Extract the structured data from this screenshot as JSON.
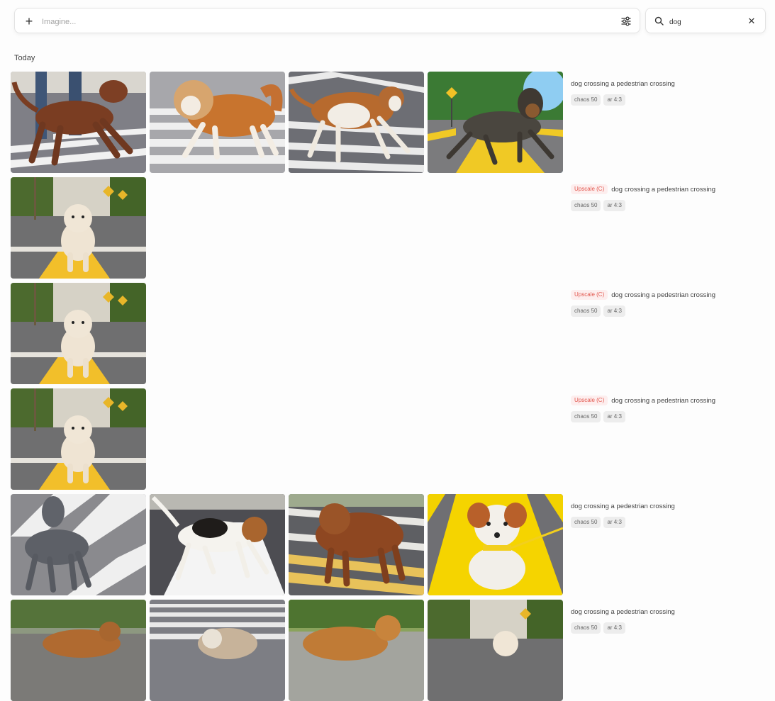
{
  "toolbar": {
    "prompt_placeholder": "Imagine...",
    "prompt_value": "",
    "search_value": "dog",
    "plus_icon": "plus-icon",
    "settings_icon": "sliders-icon",
    "search_icon": "search-icon",
    "clear_icon": "close-icon",
    "plus_glyph": "+",
    "clear_glyph": "✕"
  },
  "section": {
    "label": "Today"
  },
  "rows": [
    {
      "upscale": "",
      "prompt": "dog crossing a pedestrian crossing",
      "params": [
        "chaos 50",
        "ar 4:3"
      ]
    },
    {
      "upscale": "Upscale (C)",
      "prompt": "dog crossing a pedestrian crossing",
      "params": [
        "chaos 50",
        "ar 4:3"
      ]
    },
    {
      "upscale": "Upscale (C)",
      "prompt": "dog crossing a pedestrian crossing",
      "params": [
        "chaos 50",
        "ar 4:3"
      ]
    },
    {
      "upscale": "Upscale (C)",
      "prompt": "dog crossing a pedestrian crossing",
      "params": [
        "chaos 50",
        "ar 4:3"
      ]
    },
    {
      "upscale": "",
      "prompt": "dog crossing a pedestrian crossing",
      "params": [
        "chaos 50",
        "ar 4:3"
      ]
    },
    {
      "upscale": "",
      "prompt": "dog crossing a pedestrian crossing",
      "params": [
        "chaos 50",
        "ar 4:3"
      ]
    }
  ],
  "colors": {
    "upscale_text": "#e2584f",
    "upscale_bg": "#fdeeee",
    "param_bg": "#ededed",
    "border": "#e3e3e3"
  }
}
